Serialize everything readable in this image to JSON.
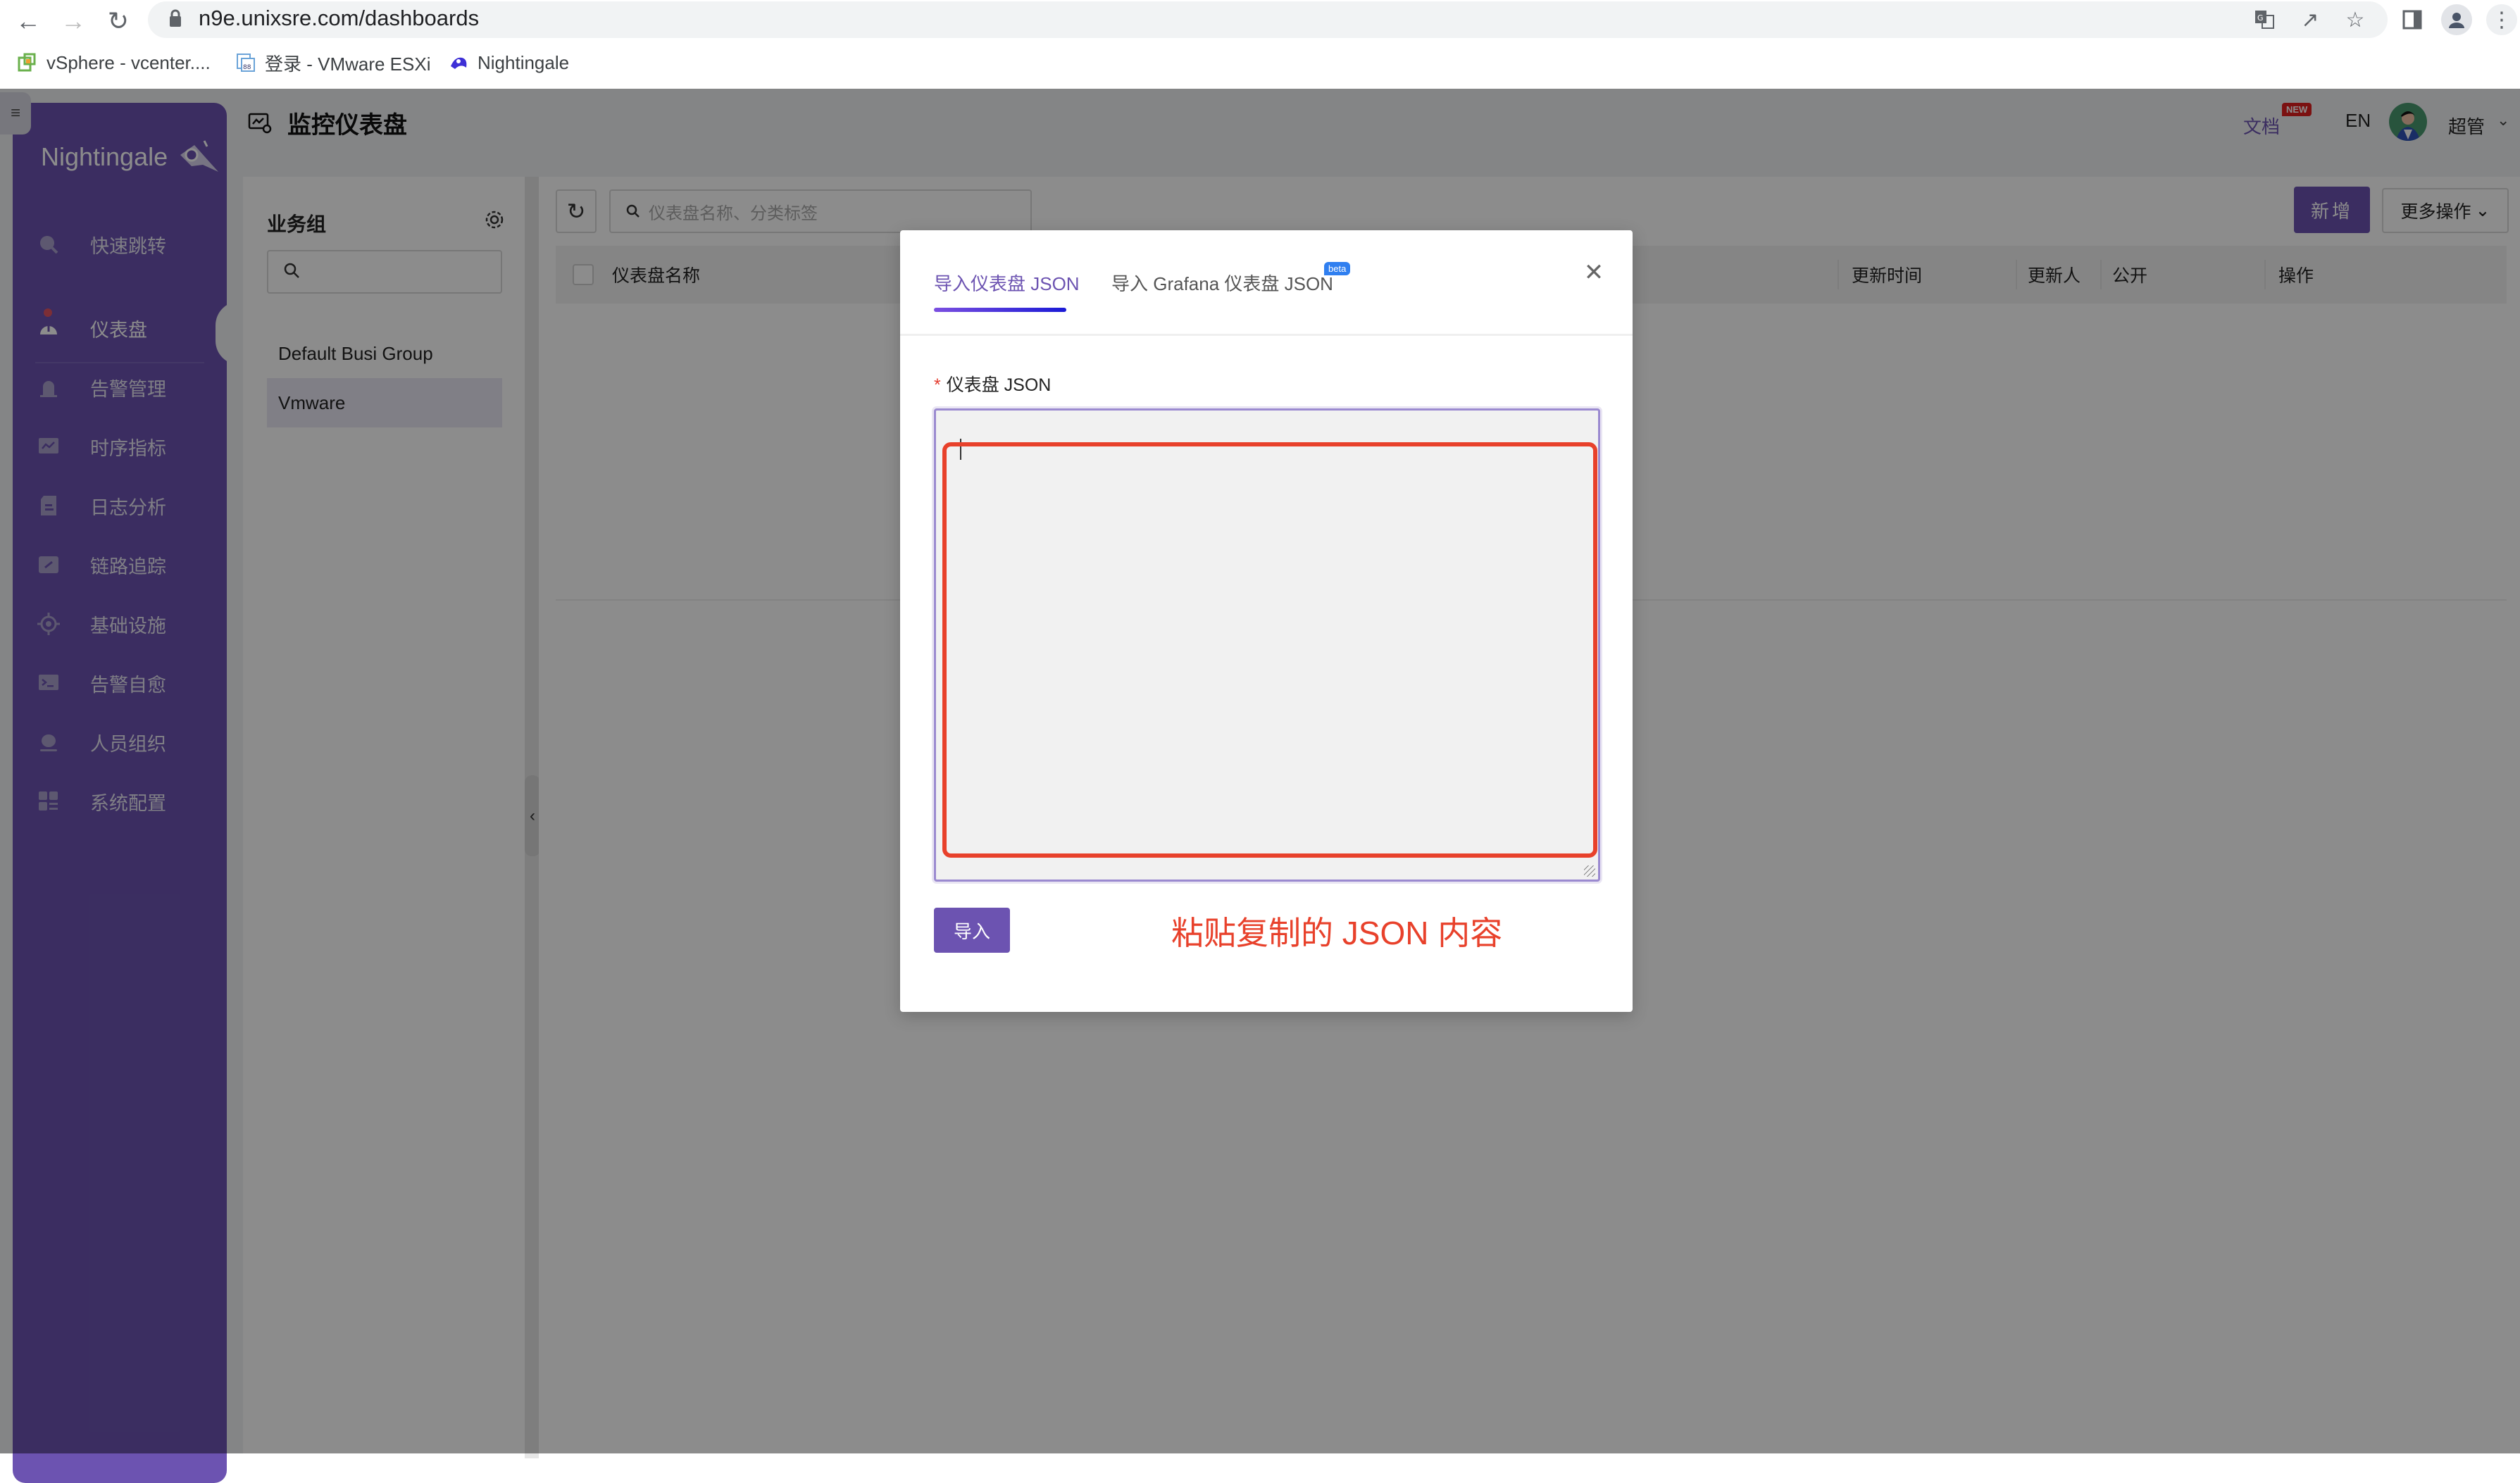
{
  "browser": {
    "url": "n9e.unixsre.com/dashboards",
    "bookmarks": [
      {
        "label": "vSphere - vcenter...."
      },
      {
        "label": "登录 - VMware ESXi"
      },
      {
        "label": "Nightingale"
      }
    ]
  },
  "app": {
    "logo": "Nightingale",
    "page_title": "监控仪表盘",
    "header": {
      "docs": "文档",
      "docs_badge": "NEW",
      "lang": "EN",
      "user": "超管"
    },
    "sidebar": {
      "items": [
        {
          "label": "快速跳转",
          "icon": "search-icon"
        },
        {
          "label": "仪表盘",
          "icon": "dashboard-icon",
          "active": true
        },
        {
          "label": "告警管理",
          "icon": "alarm-icon"
        },
        {
          "label": "时序指标",
          "icon": "chart-icon"
        },
        {
          "label": "日志分析",
          "icon": "log-icon"
        },
        {
          "label": "链路追踪",
          "icon": "link-icon"
        },
        {
          "label": "基础设施",
          "icon": "target-icon"
        },
        {
          "label": "告警自愈",
          "icon": "terminal-icon"
        },
        {
          "label": "人员组织",
          "icon": "user-icon"
        },
        {
          "label": "系统配置",
          "icon": "settings-grid-icon"
        }
      ]
    },
    "business_groups": {
      "title": "业务组",
      "search_placeholder": "",
      "items": [
        {
          "label": "Default Busi Group",
          "active": false
        },
        {
          "label": "Vmware",
          "active": true
        }
      ]
    },
    "main": {
      "search_placeholder": "仪表盘名称、分类标签",
      "add_label": "新增",
      "more_label": "更多操作",
      "columns": [
        "仪表盘名称",
        "更新时间",
        "更新人",
        "公开",
        "操作"
      ]
    }
  },
  "modal": {
    "tabs": [
      {
        "label": "导入仪表盘 JSON",
        "active": true
      },
      {
        "label": "导入 Grafana 仪表盘 JSON",
        "badge": "beta"
      }
    ],
    "field_label": "仪表盘 JSON",
    "json_value": "",
    "import_label": "导入",
    "annotation": "粘贴复制的 JSON 内容"
  },
  "colors": {
    "brand": "#6c53b1",
    "annotation": "#e8412b"
  }
}
